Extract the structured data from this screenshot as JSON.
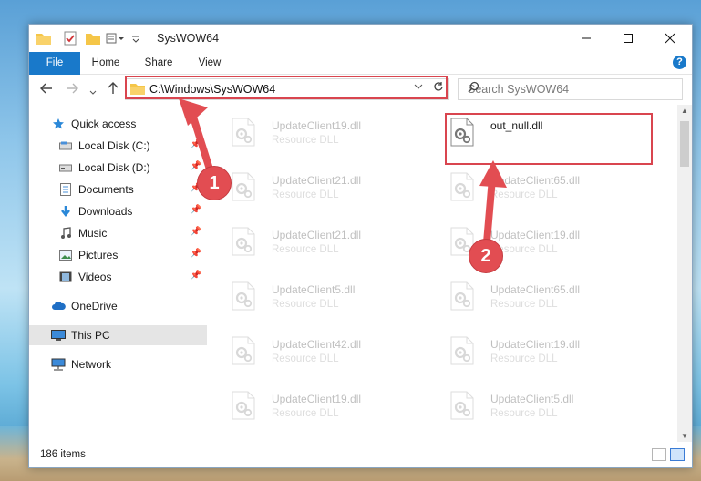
{
  "window": {
    "title": "SysWOW64"
  },
  "ribbon": {
    "tabs": [
      {
        "label": "File"
      },
      {
        "label": "Home"
      },
      {
        "label": "Share"
      },
      {
        "label": "View"
      }
    ],
    "help_label": "?"
  },
  "address": {
    "path": "C:\\Windows\\SysWOW64"
  },
  "search": {
    "placeholder": "Search SysWOW64"
  },
  "sidebar": {
    "items": [
      {
        "label": "Quick access",
        "icon": "star-icon"
      },
      {
        "label": "Local Disk (C:)",
        "icon": "drive-icon"
      },
      {
        "label": "Local Disk (D:)",
        "icon": "drive-icon"
      },
      {
        "label": "Documents",
        "icon": "documents-icon"
      },
      {
        "label": "Downloads",
        "icon": "download-icon"
      },
      {
        "label": "Music",
        "icon": "music-icon"
      },
      {
        "label": "Pictures",
        "icon": "pictures-icon"
      },
      {
        "label": "Videos",
        "icon": "videos-icon"
      },
      {
        "label": "OneDrive",
        "icon": "cloud-icon"
      },
      {
        "label": "This PC",
        "icon": "computer-icon"
      },
      {
        "label": "Network",
        "icon": "network-icon"
      }
    ]
  },
  "files": [
    {
      "name": "UpdateClient19.dll",
      "type": "Resource DLL"
    },
    {
      "name": "out_null.dll",
      "type": ""
    },
    {
      "name": "UpdateClient21.dll",
      "type": "Resource DLL"
    },
    {
      "name": "UpdateClient65.dll",
      "type": "Resource DLL"
    },
    {
      "name": "UpdateClient21.dll",
      "type": "Resource DLL"
    },
    {
      "name": "UpdateClient19.dll",
      "type": "Resource DLL"
    },
    {
      "name": "UpdateClient5.dll",
      "type": "Resource DLL"
    },
    {
      "name": "UpdateClient65.dll",
      "type": "Resource DLL"
    },
    {
      "name": "UpdateClient42.dll",
      "type": "Resource DLL"
    },
    {
      "name": "UpdateClient19.dll",
      "type": "Resource DLL"
    },
    {
      "name": "UpdateClient19.dll",
      "type": "Resource DLL"
    },
    {
      "name": "UpdateClient5.dll",
      "type": "Resource DLL"
    }
  ],
  "status": {
    "item_count": "186 items"
  },
  "annotations": {
    "step1": "1",
    "step2": "2"
  },
  "colors": {
    "accent": "#1979ca",
    "highlight": "#d9454f"
  }
}
